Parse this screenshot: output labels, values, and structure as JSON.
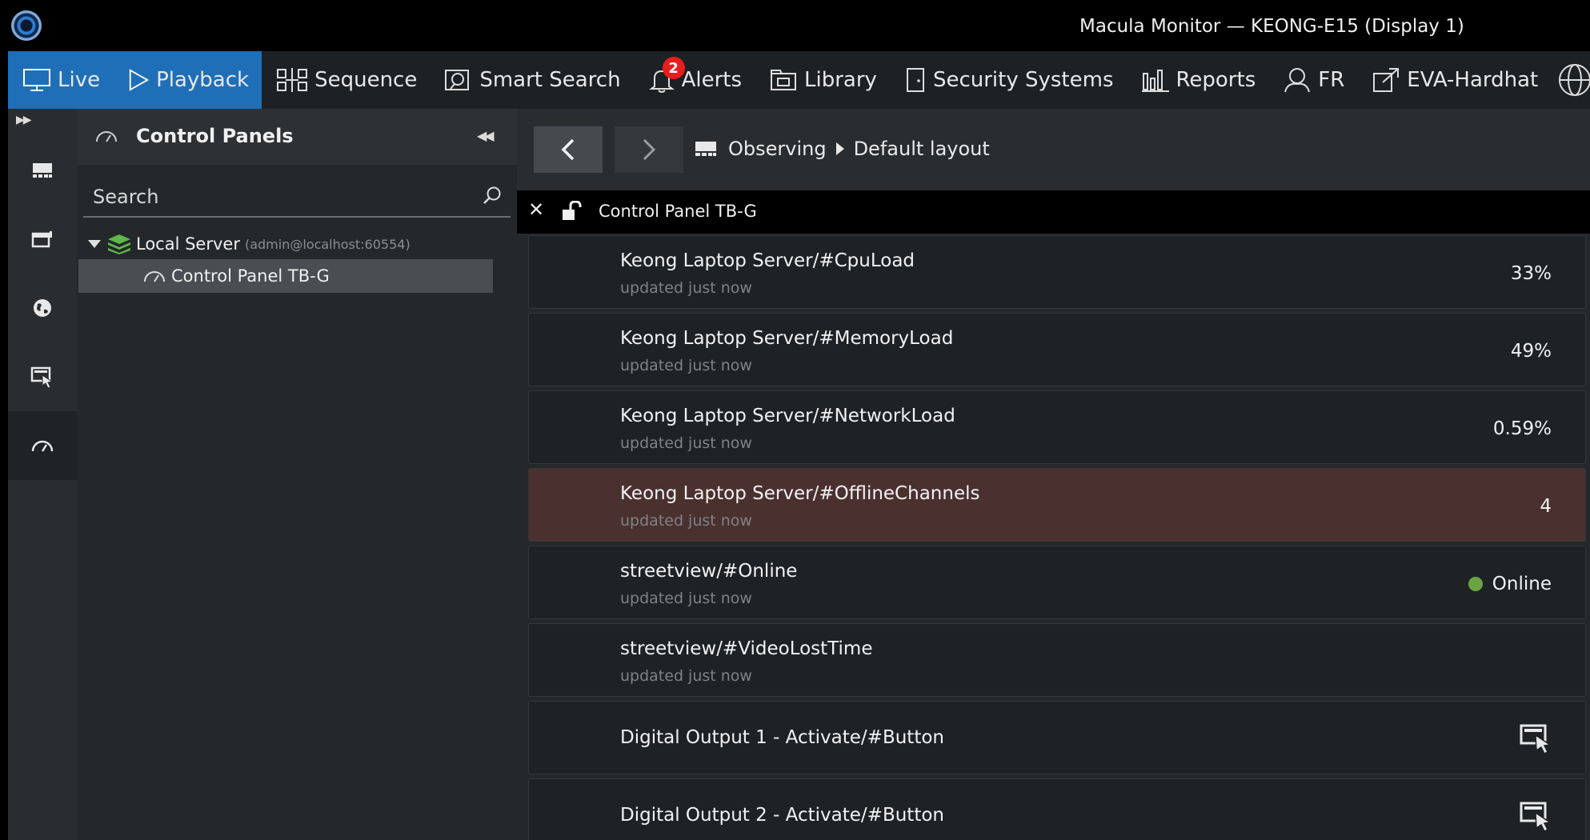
{
  "window": {
    "title": "Macula Monitor — KEONG-E15 (Display 1)"
  },
  "topnav": {
    "items": [
      {
        "label": "Live",
        "icon": "monitor-icon",
        "active": true
      },
      {
        "label": "Playback",
        "icon": "play-icon"
      },
      {
        "label": "Sequence",
        "icon": "sequence-icon"
      },
      {
        "label": "Smart Search",
        "icon": "smart-search-icon"
      },
      {
        "label": "Alerts",
        "icon": "bell-icon",
        "badge": "2"
      },
      {
        "label": "Library",
        "icon": "library-icon"
      },
      {
        "label": "Security Systems",
        "icon": "door-icon"
      },
      {
        "label": "Reports",
        "icon": "bar-chart-icon"
      },
      {
        "label": "FR",
        "icon": "face-icon"
      },
      {
        "label": "EVA-Hardhat",
        "icon": "external-link-icon"
      }
    ]
  },
  "sidebar": {
    "title": "Control Panels",
    "search_placeholder": "Search",
    "server": {
      "label": "Local Server",
      "detail": "(admin@localhost:60554)"
    },
    "panel_item": "Control Panel TB-G"
  },
  "main": {
    "breadcrumb": [
      "Observing",
      "Default layout"
    ],
    "tab_title": "Control Panel TB-G",
    "rows": [
      {
        "name": "Keong Laptop Server/#CpuLoad",
        "updated": "updated just now",
        "value": "33%"
      },
      {
        "name": "Keong Laptop Server/#MemoryLoad",
        "updated": "updated just now",
        "value": "49%"
      },
      {
        "name": "Keong Laptop Server/#NetworkLoad",
        "updated": "updated just now",
        "value": "0.59%"
      },
      {
        "name": "Keong Laptop Server/#OfflineChannels",
        "updated": "updated just now",
        "value": "4",
        "alert": true
      },
      {
        "name": "streetview/#Online",
        "updated": "updated just now",
        "value": "Online",
        "status_color": "#6aa442"
      },
      {
        "name": "streetview/#VideoLostTime",
        "updated": "updated just now",
        "value": ""
      },
      {
        "name": "Digital Output 1 - Activate/#Button",
        "updated": "",
        "action": "activate-button-icon"
      },
      {
        "name": "Digital Output 2 - Activate/#Button",
        "updated": "",
        "action": "activate-button-icon"
      }
    ]
  },
  "colors": {
    "accent": "#1f6fb8",
    "alert_row": "#4a302e",
    "online": "#6aa442",
    "badge": "#e81d1d"
  }
}
